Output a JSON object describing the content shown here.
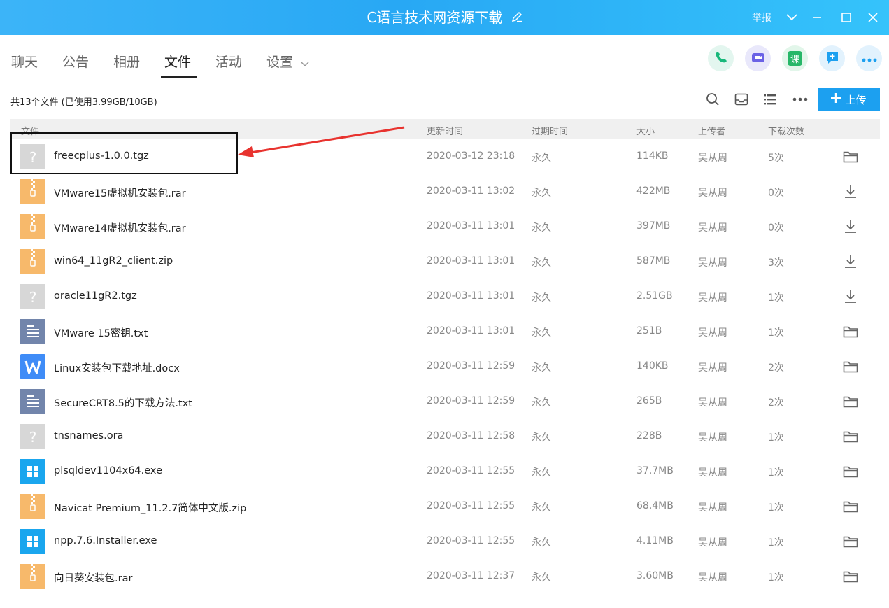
{
  "window": {
    "title": "C语言技术网资源下载",
    "report": "举报"
  },
  "tabs": [
    {
      "label": "聊天"
    },
    {
      "label": "公告"
    },
    {
      "label": "相册"
    },
    {
      "label": "文件",
      "active": true
    },
    {
      "label": "活动"
    },
    {
      "label": "设置"
    }
  ],
  "actions": {
    "call": "phone-icon",
    "video": "video-icon",
    "course_label": "课",
    "add": "add-icon",
    "more": "more-icon"
  },
  "files_panel": {
    "summary": "共13个文件 (已使用3.99GB/10GB)",
    "upload_label": "上传",
    "columns": {
      "name": "文件",
      "updated": "更新时间",
      "expires": "过期时间",
      "size": "大小",
      "uploader": "上传者",
      "downloads": "下载次数"
    },
    "rows": [
      {
        "name": "freecplus-1.0.0.tgz",
        "type": "unknown",
        "updated": "2020-03-12 23:18",
        "expires": "永久",
        "size": "114KB",
        "uploader": "吴从周",
        "downloads": "5次",
        "action": "folder"
      },
      {
        "name": "VMware15虚拟机安装包.rar",
        "type": "zip",
        "updated": "2020-03-11 13:02",
        "expires": "永久",
        "size": "422MB",
        "uploader": "吴从周",
        "downloads": "0次",
        "action": "download"
      },
      {
        "name": "VMware14虚拟机安装包.rar",
        "type": "zip",
        "updated": "2020-03-11 13:01",
        "expires": "永久",
        "size": "397MB",
        "uploader": "吴从周",
        "downloads": "0次",
        "action": "download"
      },
      {
        "name": "win64_11gR2_client.zip",
        "type": "zip",
        "updated": "2020-03-11 13:01",
        "expires": "永久",
        "size": "587MB",
        "uploader": "吴从周",
        "downloads": "3次",
        "action": "download"
      },
      {
        "name": "oracle11gR2.tgz",
        "type": "unknown",
        "updated": "2020-03-11 13:01",
        "expires": "永久",
        "size": "2.51GB",
        "uploader": "吴从周",
        "downloads": "1次",
        "action": "download"
      },
      {
        "name": "VMware 15密钥.txt",
        "type": "txt",
        "updated": "2020-03-11 13:01",
        "expires": "永久",
        "size": "251B",
        "uploader": "吴从周",
        "downloads": "1次",
        "action": "folder"
      },
      {
        "name": "Linux安装包下载地址.docx",
        "type": "doc",
        "updated": "2020-03-11 12:59",
        "expires": "永久",
        "size": "140KB",
        "uploader": "吴从周",
        "downloads": "2次",
        "action": "folder"
      },
      {
        "name": "SecureCRT8.5的下载方法.txt",
        "type": "txt",
        "updated": "2020-03-11 12:59",
        "expires": "永久",
        "size": "265B",
        "uploader": "吴从周",
        "downloads": "2次",
        "action": "folder"
      },
      {
        "name": "tnsnames.ora",
        "type": "unknown",
        "updated": "2020-03-11 12:58",
        "expires": "永久",
        "size": "228B",
        "uploader": "吴从周",
        "downloads": "1次",
        "action": "folder"
      },
      {
        "name": "plsqldev1104x64.exe",
        "type": "exe",
        "updated": "2020-03-11 12:55",
        "expires": "永久",
        "size": "37.7MB",
        "uploader": "吴从周",
        "downloads": "1次",
        "action": "folder"
      },
      {
        "name": "Navicat Premium_11.2.7简体中文版.zip",
        "type": "zip",
        "updated": "2020-03-11 12:55",
        "expires": "永久",
        "size": "68.4MB",
        "uploader": "吴从周",
        "downloads": "1次",
        "action": "folder"
      },
      {
        "name": "npp.7.6.Installer.exe",
        "type": "exe",
        "updated": "2020-03-11 12:55",
        "expires": "永久",
        "size": "4.11MB",
        "uploader": "吴从周",
        "downloads": "1次",
        "action": "folder"
      },
      {
        "name": "向日葵安装包.rar",
        "type": "zip",
        "updated": "2020-03-11 12:37",
        "expires": "永久",
        "size": "3.60MB",
        "uploader": "吴从周",
        "downloads": "1次",
        "action": "folder"
      }
    ]
  },
  "annotation": {
    "color": "#e8332f"
  }
}
